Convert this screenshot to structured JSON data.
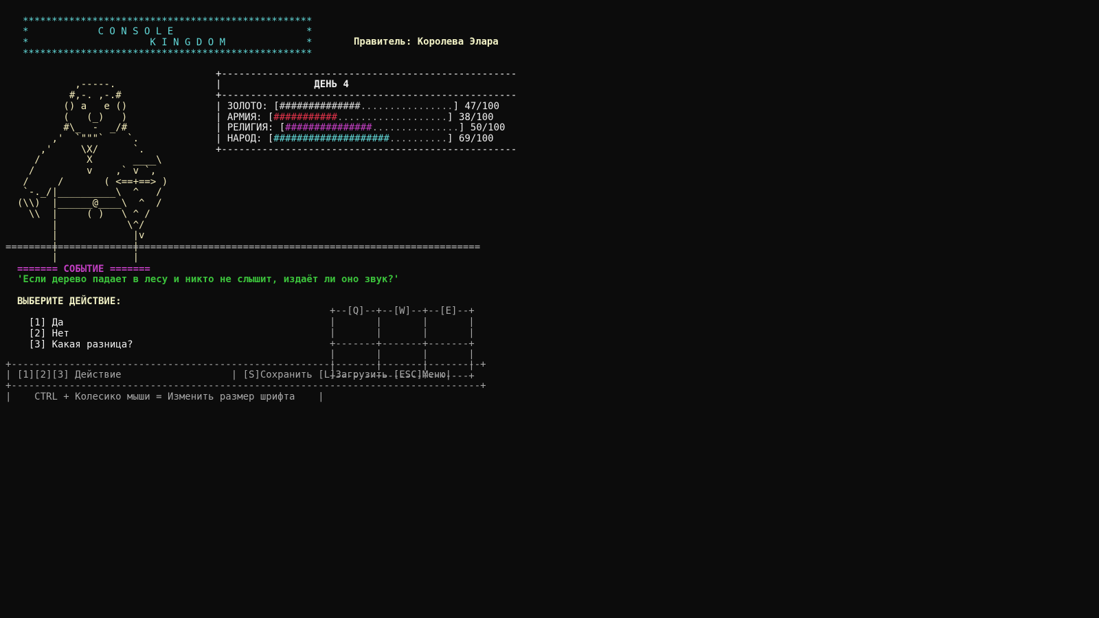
{
  "title": {
    "border": "**************************************************",
    "line1": "*            C O N S O L E                       *",
    "line2": "*                     K I N G D O M              *"
  },
  "ruler": {
    "label": "Правитель:",
    "name": "Королева Элара"
  },
  "portrait": {
    "lines": [
      "          ,-----.",
      "         #,-. ,-.#",
      "        () a   e ()",
      "        (   (_)   )",
      "        #\\_  -  _/#",
      "      ,'  `\"\"\"`    `.",
      "    ,'     \\X/      `.",
      "   /        X       ____\\",
      "  /         v    ,` v `,",
      " /     /       ( <==+==> )",
      " `-._/|__________\\  ^   /",
      "(\\\\)  |______@____\\  ^  /",
      "  \\\\  |     ( )   \\ ^ /",
      "      |            \\^/",
      "      |             |v",
      "      |             |",
      "      |             |"
    ]
  },
  "stats": {
    "border": "+---------------------------------------------------",
    "day_label": "ДЕНЬ 4",
    "rows": [
      {
        "label": "ЗОЛОТО:",
        "fill": "##############",
        "empty": "................",
        "value": "47/100",
        "kind": "gold"
      },
      {
        "label": "АРМИЯ:",
        "fill": "###########",
        "empty": "...................",
        "value": "38/100",
        "kind": "army"
      },
      {
        "label": "РЕЛИГИЯ:",
        "fill": "###############",
        "empty": "...............",
        "value": "50/100",
        "kind": "rel"
      },
      {
        "label": "НАРОД:",
        "fill": "####################",
        "empty": "..........",
        "value": "69/100",
        "kind": "people"
      }
    ]
  },
  "divider": "==================================================================================",
  "event": {
    "header": "======= СОБЫТИЕ =======",
    "quote": "'Если дерево падает в лесу и никто не слышит, издаёт ли оно звук?'",
    "prompt": "ВЫБЕРИТЕ ДЕЙСТВИЕ:",
    "options": [
      {
        "key": "[1]",
        "label": "Да"
      },
      {
        "key": "[2]",
        "label": "Нет"
      },
      {
        "key": "[3]",
        "label": "Какая разница?"
      }
    ]
  },
  "grid": {
    "keys": [
      "[Q]",
      "[W]",
      "[E]"
    ]
  },
  "footer": {
    "border": "+---------------------------------------------------------------------------------+",
    "actions": "[1][2][3] Действие",
    "save": "[S]Сохранить",
    "load": "[L]Загрузить",
    "menu": "[ESC]Меню",
    "hint": "CTRL + Колесико мыши = Изменить размер шрифта"
  }
}
